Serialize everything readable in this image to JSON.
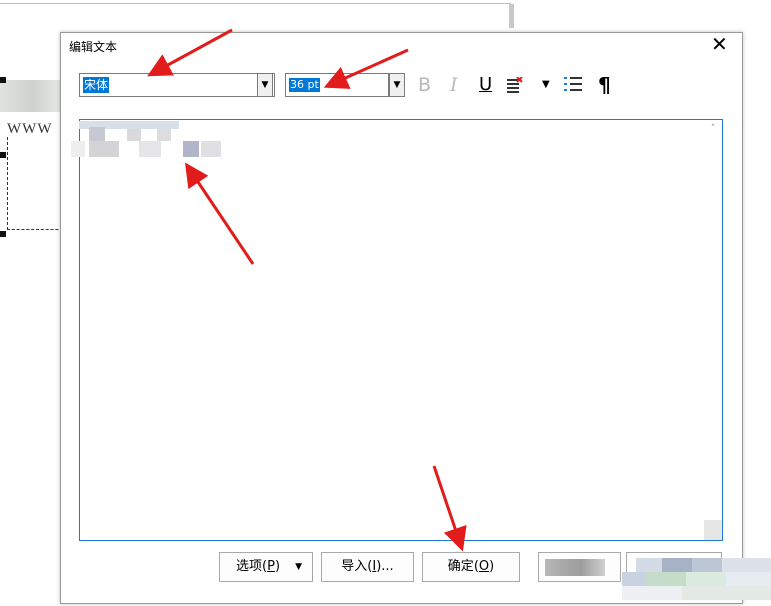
{
  "background_doc": {
    "text": "WWW"
  },
  "dialog": {
    "title": "编辑文本",
    "close_label": "✕"
  },
  "toolbar": {
    "font_name": "宋体",
    "font_size": "36 pt",
    "bold_label": "B",
    "italic_label": "I",
    "underline_label": "U",
    "paragraph_label": "¶",
    "dropdown_glyph": "▼"
  },
  "buttons": {
    "options_label": "选项",
    "options_key": "P",
    "import_label": "导入",
    "import_key": "I",
    "import_suffix": "...",
    "ok_label": "确定",
    "ok_key": "O"
  },
  "colors": {
    "accent": "#0078d7",
    "arrow": "#e21b1b",
    "text_area_border": "#1e7bd2"
  }
}
